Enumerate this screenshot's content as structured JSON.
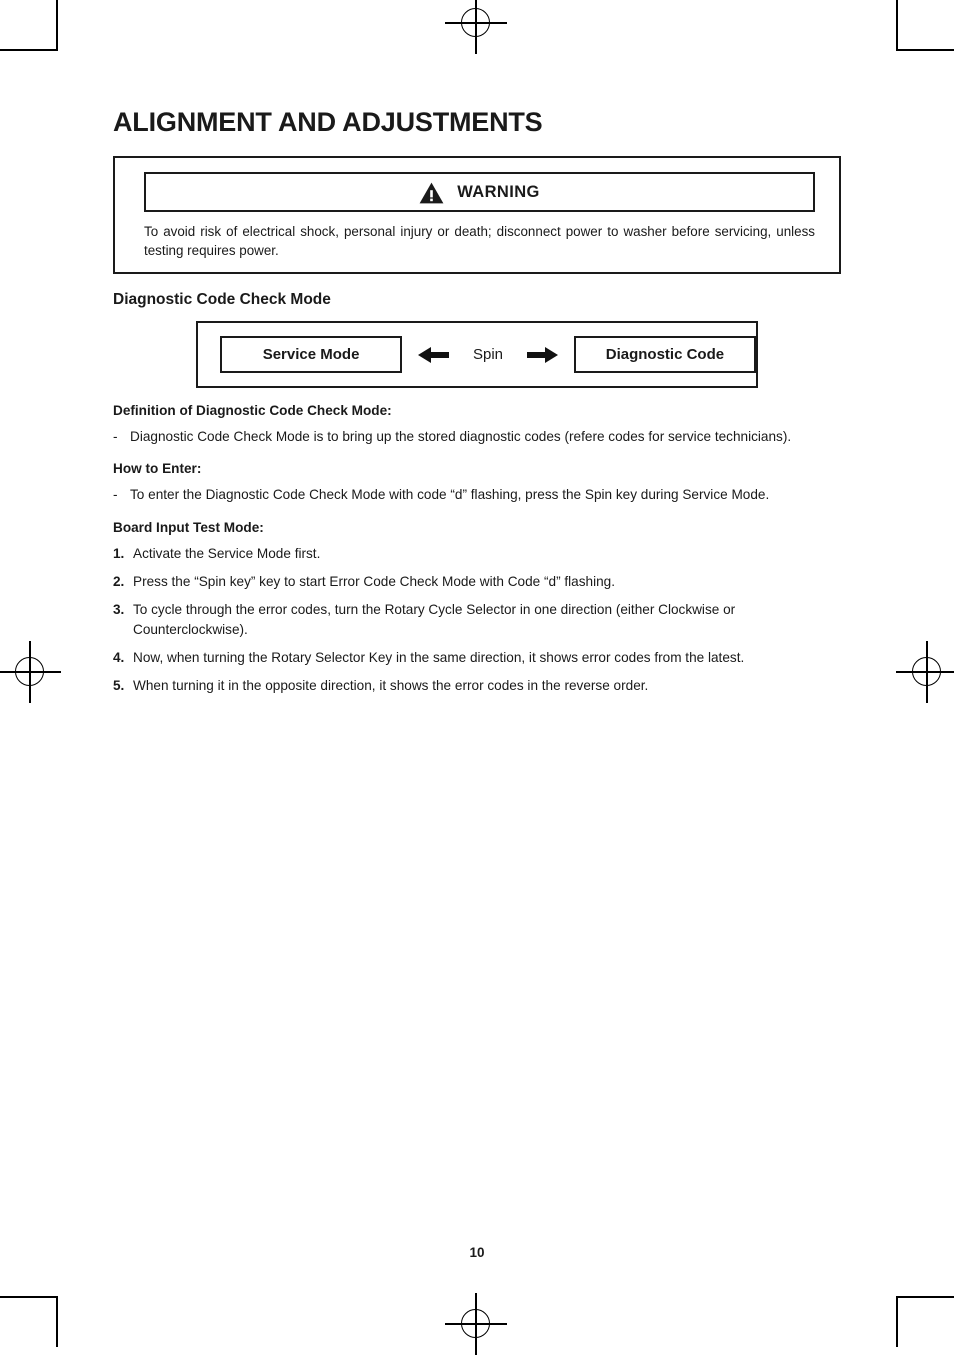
{
  "document": {
    "title": "ALIGNMENT AND ADJUSTMENTS",
    "page_number": "10"
  },
  "warning": {
    "icon": "warning-triangle-icon",
    "label": "WARNING",
    "text": "To avoid risk of electrical shock, personal injury or death; disconnect power to washer before servicing, unless testing requires power."
  },
  "section": {
    "heading": "Diagnostic Code Check Mode"
  },
  "flow_diagram": {
    "left_box": "Service Mode",
    "arrow_left_icon": "arrow-left-icon",
    "center_label": "Spin",
    "arrow_right_icon": "arrow-right-icon",
    "right_box": "Diagnostic Code"
  },
  "definition": {
    "heading": "Definition of Diagnostic Code Check Mode:",
    "items": [
      {
        "marker": "-",
        "text": "Diagnostic Code Check Mode is to bring up the stored diagnostic codes (refere codes for service technicians)."
      }
    ]
  },
  "how_to_enter": {
    "heading": "How to Enter:",
    "items": [
      {
        "marker": "-",
        "text": "To enter the Diagnostic Code Check Mode with code “d” flashing, press the Spin key during Service Mode."
      }
    ]
  },
  "board_input_test": {
    "heading": "Board Input Test Mode:",
    "items": [
      {
        "marker": "1.",
        "text": "Activate the Service Mode first."
      },
      {
        "marker": "2.",
        "text": "Press the “Spin key” key to start Error Code Check Mode with Code “d” flashing."
      },
      {
        "marker": "3.",
        "text": "To cycle through the error codes, turn the Rotary Cycle Selector in one direction (either Clockwise or Counterclockwise)."
      },
      {
        "marker": "4.",
        "text": "Now, when turning the Rotary Selector Key in the same direction, it shows error codes from the latest."
      },
      {
        "marker": "5.",
        "text": "When turning it in the opposite direction, it shows the error codes in the reverse order."
      }
    ]
  },
  "print_marks": {
    "crop_corners": [
      "top-left",
      "top-right",
      "bottom-left",
      "bottom-right"
    ],
    "registration_marks": [
      "top-center",
      "bottom-center",
      "left-middle",
      "right-middle"
    ]
  }
}
